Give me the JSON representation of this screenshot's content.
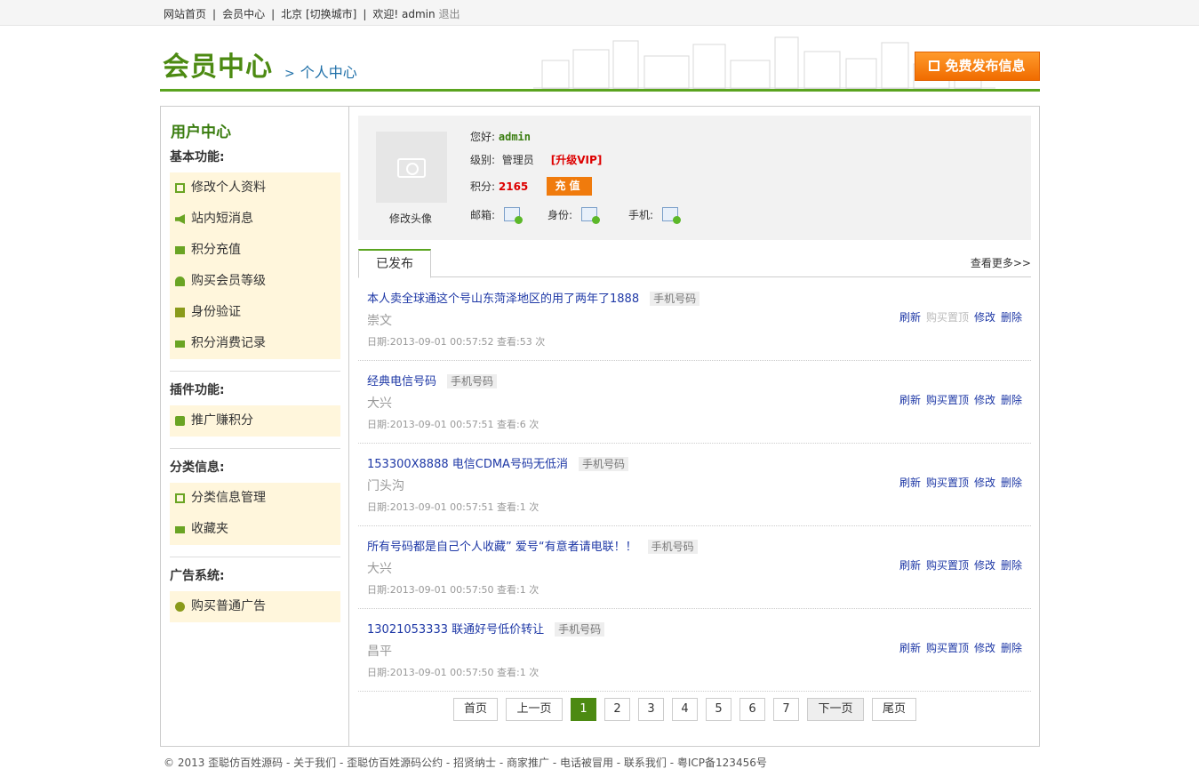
{
  "topbar": {
    "home": "网站首页",
    "member": "会员中心",
    "city": "北京",
    "switch_city": "[切换城市]",
    "welcome": "欢迎! admin",
    "logout": "退出"
  },
  "header": {
    "title": "会员中心",
    "subtitle": "个人中心",
    "publish_button": "免费发布信息"
  },
  "sidebar": {
    "title": "用户中心",
    "sections": [
      {
        "title": "基本功能:",
        "items": [
          "修改个人资料",
          "站内短消息",
          "积分充值",
          "购买会员等级",
          "身份验证",
          "积分消费记录"
        ]
      },
      {
        "title": "插件功能:",
        "items": [
          "推广赚积分"
        ]
      },
      {
        "title": "分类信息:",
        "items": [
          "分类信息管理",
          "收藏夹"
        ]
      },
      {
        "title": "广告系统:",
        "items": [
          "购买普通广告"
        ]
      }
    ]
  },
  "profile": {
    "avatar_label": "修改头像",
    "greeting_label": "您好:",
    "username": "admin",
    "level_label": "级别:",
    "level": "管理员",
    "upgrade": "[升级VIP]",
    "points_label": "积分:",
    "points": "2165",
    "recharge": "充值",
    "email_label": "邮箱:",
    "id_label": "身份:",
    "phone_label": "手机:"
  },
  "tabs": {
    "published": "已发布",
    "more": "查看更多>>"
  },
  "listings": [
    {
      "title": "本人卖全球通这个号山东菏泽地区的用了两年了1888",
      "tag": "手机号码",
      "location": "崇文",
      "meta": "日期:2013-09-01 00:57:52 查看:53 次",
      "actions": [
        "刷新",
        "购买置顶",
        "修改",
        "删除"
      ],
      "disabled": [
        1
      ]
    },
    {
      "title": "经典电信号码",
      "tag": "手机号码",
      "location": "大兴",
      "meta": "日期:2013-09-01 00:57:51 查看:6 次",
      "actions": [
        "刷新",
        "购买置顶",
        "修改",
        "删除"
      ],
      "disabled": []
    },
    {
      "title": "153300X8888 电信CDMA号码无低消",
      "tag": "手机号码",
      "location": "门头沟",
      "meta": "日期:2013-09-01 00:57:51 查看:1 次",
      "actions": [
        "刷新",
        "购买置顶",
        "修改",
        "删除"
      ],
      "disabled": []
    },
    {
      "title": "所有号码都是自己个人收藏” 爱号“有意者请电联！！",
      "tag": "手机号码",
      "location": "大兴",
      "meta": "日期:2013-09-01 00:57:50 查看:1 次",
      "actions": [
        "刷新",
        "购买置顶",
        "修改",
        "删除"
      ],
      "disabled": []
    },
    {
      "title": "13021053333 联通好号低价转让",
      "tag": "手机号码",
      "location": "昌平",
      "meta": "日期:2013-09-01 00:57:50 查看:1 次",
      "actions": [
        "刷新",
        "购买置顶",
        "修改",
        "删除"
      ],
      "disabled": []
    }
  ],
  "pager": [
    "首页",
    "上一页",
    "1",
    "2",
    "3",
    "4",
    "5",
    "6",
    "7",
    "下一页",
    "尾页"
  ],
  "pager_current": "1",
  "footer": "© 2013 歪聪仿百姓源码 - 关于我们 - 歪聪仿百姓源码公约 - 招贤纳士 - 商家推广 - 电话被冒用 - 联系我们 - 粤ICP备123456号",
  "colors": {
    "brand_green": "#4c8a12",
    "accent_orange": "#f07b0d",
    "link_blue": "#1e38a6"
  }
}
